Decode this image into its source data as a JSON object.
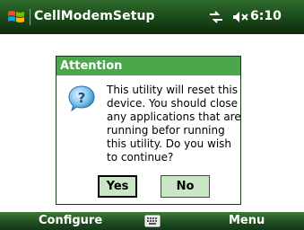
{
  "titlebar": {
    "app_title": "CellModemSetup",
    "clock": "6:10",
    "icons": [
      "windows-start-icon",
      "connectivity-icon",
      "volume-muted-icon"
    ]
  },
  "dialog": {
    "title": "Attention",
    "message": "This utility will reset this device.  You should close any applications that are running befor running this utility.  Do you wish to continue?",
    "icon": "question-icon",
    "yes_label": "Yes",
    "no_label": "No"
  },
  "softkeys": {
    "left": "Configure",
    "center_icon": "keyboard-icon",
    "right": "Menu"
  },
  "colors": {
    "titlebar": "#1e4f1d",
    "dialog_header": "#4aa84a",
    "button_fill": "#c9e7c4"
  }
}
